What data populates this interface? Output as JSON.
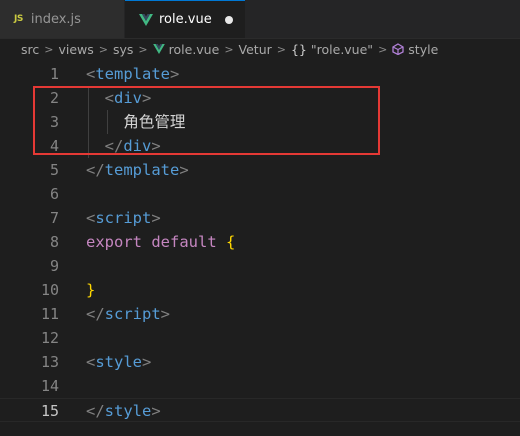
{
  "tabs": [
    {
      "label": "index.js",
      "icon": "js-icon",
      "active": false
    },
    {
      "label": "role.vue",
      "icon": "vue-icon",
      "active": true,
      "unsaved": true
    }
  ],
  "breadcrumb": {
    "items": [
      "src",
      "views",
      "sys",
      "role.vue",
      "Vetur",
      "\"role.vue\"",
      "style"
    ]
  },
  "editor": {
    "active_line": 15,
    "lines": [
      {
        "n": "1",
        "indent": "",
        "parts": [
          [
            "tag-br",
            "<"
          ],
          [
            "tag-name",
            "template"
          ],
          [
            "tag-br",
            ">"
          ]
        ]
      },
      {
        "n": "2",
        "indent": "  ",
        "parts": [
          [
            "tag-br",
            "<"
          ],
          [
            "tag-name",
            "div"
          ],
          [
            "tag-br",
            ">"
          ]
        ]
      },
      {
        "n": "3",
        "indent": "    ",
        "parts": [
          [
            "cjk",
            "角色管理"
          ]
        ]
      },
      {
        "n": "4",
        "indent": "  ",
        "parts": [
          [
            "tag-br",
            "</"
          ],
          [
            "tag-name",
            "div"
          ],
          [
            "tag-br",
            ">"
          ]
        ]
      },
      {
        "n": "5",
        "indent": "",
        "parts": [
          [
            "tag-br",
            "</"
          ],
          [
            "tag-name",
            "template"
          ],
          [
            "tag-br",
            ">"
          ]
        ]
      },
      {
        "n": "6",
        "indent": "",
        "parts": []
      },
      {
        "n": "7",
        "indent": "",
        "parts": [
          [
            "tag-br",
            "<"
          ],
          [
            "tag-name",
            "script"
          ],
          [
            "tag-br",
            ">"
          ]
        ]
      },
      {
        "n": "8",
        "indent": "",
        "parts": [
          [
            "kw",
            "export default "
          ],
          [
            "brace",
            "{"
          ]
        ]
      },
      {
        "n": "9",
        "indent": "",
        "parts": []
      },
      {
        "n": "10",
        "indent": "",
        "parts": [
          [
            "brace",
            "}"
          ]
        ]
      },
      {
        "n": "11",
        "indent": "",
        "parts": [
          [
            "tag-br",
            "</"
          ],
          [
            "tag-name",
            "script"
          ],
          [
            "tag-br",
            ">"
          ]
        ]
      },
      {
        "n": "12",
        "indent": "",
        "parts": []
      },
      {
        "n": "13",
        "indent": "",
        "parts": [
          [
            "tag-br",
            "<"
          ],
          [
            "tag-name",
            "style"
          ],
          [
            "tag-br",
            ">"
          ]
        ]
      },
      {
        "n": "14",
        "indent": "",
        "parts": []
      },
      {
        "n": "15",
        "indent": "",
        "parts": [
          [
            "tag-br",
            "</"
          ],
          [
            "tag-name",
            "style"
          ],
          [
            "tag-br",
            ">"
          ]
        ]
      }
    ]
  },
  "colors": {
    "background": "#1e1e1e",
    "tag_name": "#569cd6",
    "keyword": "#c586c0",
    "brace": "#ffd700",
    "highlight_box": "#e53935"
  }
}
